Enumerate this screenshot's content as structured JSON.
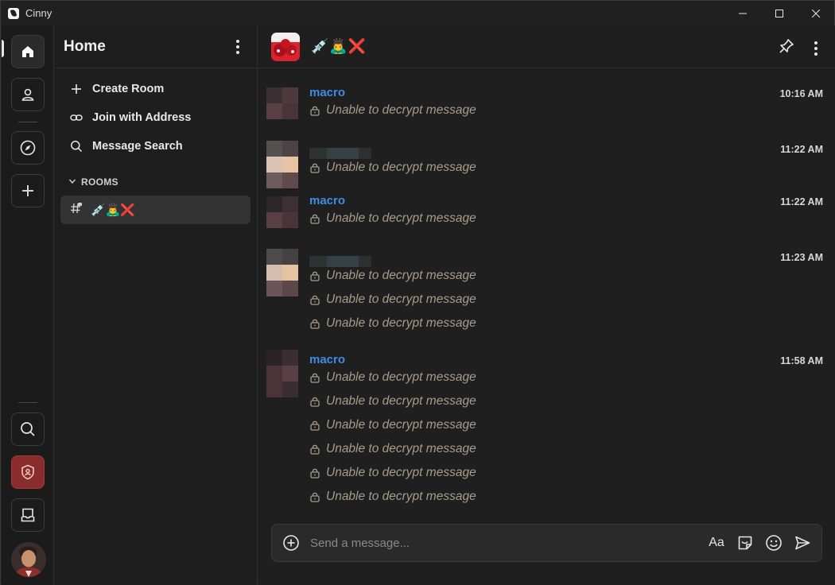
{
  "window": {
    "title": "Cinny"
  },
  "sidebar": {
    "title": "Home",
    "menu": [
      {
        "label": "Create Room",
        "icon": "plus-icon"
      },
      {
        "label": "Join with Address",
        "icon": "link-icon"
      },
      {
        "label": "Message Search",
        "icon": "search-icon"
      }
    ],
    "rooms_label": "ROOMS",
    "rooms": [
      {
        "name": "💉🙇‍♂️❌"
      }
    ]
  },
  "room": {
    "name": "💉🙇‍♂️❌",
    "messages": [
      {
        "sender": "macro",
        "time": "10:16 AM",
        "lines": [
          "Unable to decrypt message"
        ]
      },
      {
        "sender": "",
        "time": "11:22 AM",
        "lines": [
          "Unable to decrypt message"
        ]
      },
      {
        "sender": "macro",
        "time": "11:22 AM",
        "lines": [
          "Unable to decrypt message"
        ]
      },
      {
        "sender": "",
        "time": "11:23 AM",
        "lines": [
          "Unable to decrypt message",
          "Unable to decrypt message",
          "Unable to decrypt message"
        ]
      },
      {
        "sender": "macro",
        "time": "11:58 AM",
        "lines": [
          "Unable to decrypt message",
          "Unable to decrypt message",
          "Unable to decrypt message",
          "Unable to decrypt message",
          "Unable to decrypt message",
          "Unable to decrypt message"
        ]
      }
    ]
  },
  "composer": {
    "placeholder": "Send a message...",
    "format_label": "Aa"
  },
  "colors": {
    "accent_link": "#3d8ee0",
    "locked_text": "#a89c88",
    "danger": "#8a2c2c"
  }
}
